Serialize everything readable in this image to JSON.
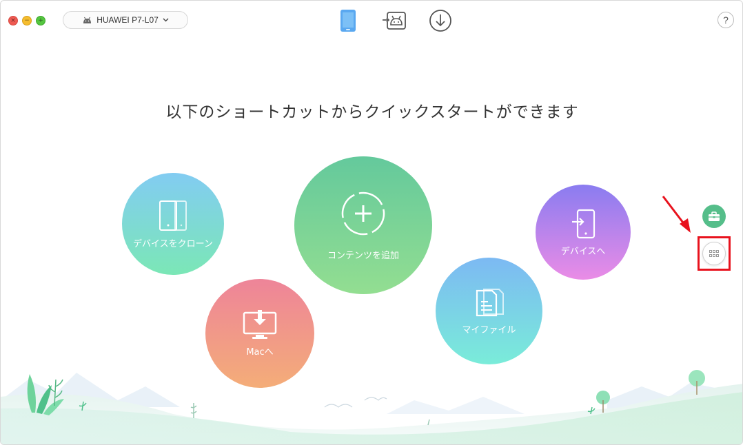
{
  "window": {
    "controls": {
      "close": "×",
      "minimize": "−",
      "maximize": "+"
    }
  },
  "device": {
    "name": "HUAWEI P7-L07",
    "icon": "android-icon",
    "dropdown_icon": "chevron-down-icon"
  },
  "toolbar": {
    "tabs": [
      {
        "name": "device-manager",
        "icon": "phone-icon",
        "active": true
      },
      {
        "name": "android-mover",
        "icon": "android-transfer-icon",
        "active": false
      },
      {
        "name": "downloader",
        "icon": "download-icon",
        "active": false
      }
    ],
    "help_label": "?"
  },
  "main": {
    "headline": "以下のショートカットからクイックスタートができます",
    "shortcuts": [
      {
        "label": "デバイスをクローン",
        "icon": "device-clone-icon"
      },
      {
        "label": "コンテンツを追加",
        "icon": "add-icon"
      },
      {
        "label": "Macへ",
        "icon": "mac-download-icon"
      },
      {
        "label": "マイファイル",
        "icon": "file-icon"
      },
      {
        "label": "デバイスへ",
        "icon": "to-device-icon"
      }
    ]
  },
  "sidebar_tools": {
    "toolbox_icon": "toolbox-icon",
    "grid_icon": "grid-icon"
  },
  "colors": {
    "accent_blue": "#5aa8f0",
    "highlight_red": "#e8121d",
    "toolbox_green": "#55be8a"
  }
}
